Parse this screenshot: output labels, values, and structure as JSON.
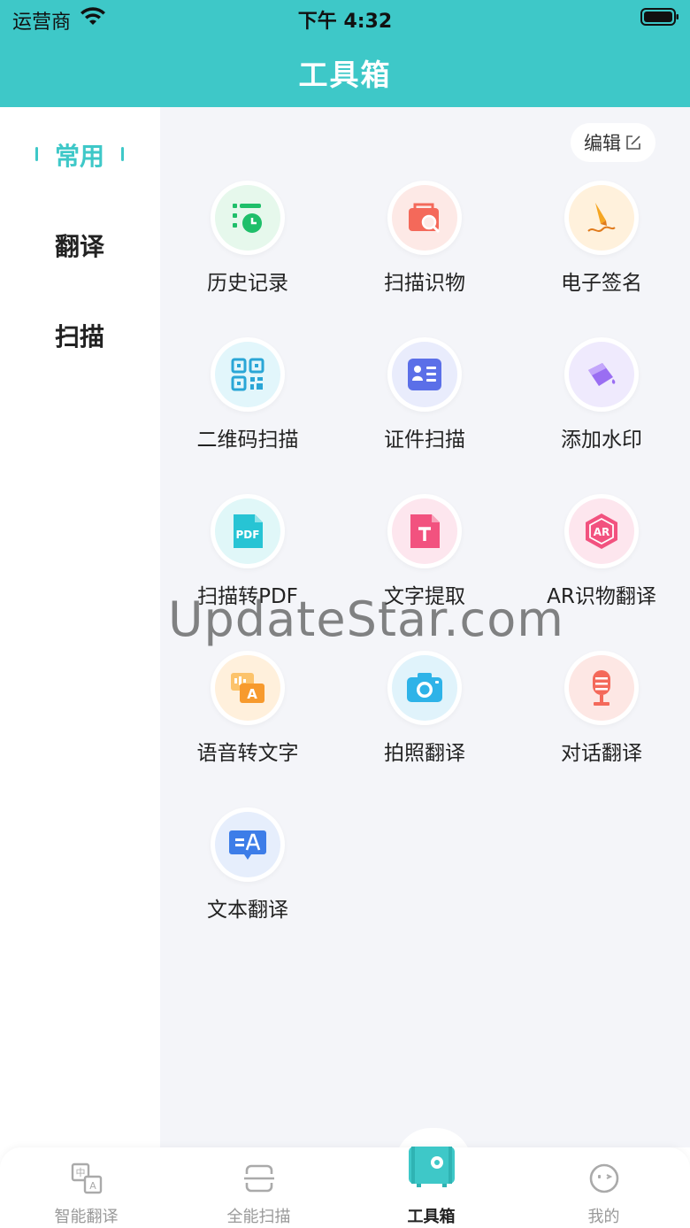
{
  "status": {
    "carrier": "运营商",
    "time": "下午 4:32"
  },
  "header": {
    "title": "工具箱"
  },
  "sidebar": {
    "items": [
      {
        "label": "常用"
      },
      {
        "label": "翻译"
      },
      {
        "label": "扫描"
      }
    ]
  },
  "edit": {
    "label": "编辑"
  },
  "tools": [
    {
      "label": "历史记录",
      "icon": "history-icon"
    },
    {
      "label": "扫描识物",
      "icon": "scan-object-icon"
    },
    {
      "label": "电子签名",
      "icon": "signature-icon"
    },
    {
      "label": "二维码扫描",
      "icon": "qrcode-icon"
    },
    {
      "label": "证件扫描",
      "icon": "id-card-icon"
    },
    {
      "label": "添加水印",
      "icon": "watermark-icon"
    },
    {
      "label": "扫描转PDF",
      "icon": "pdf-icon"
    },
    {
      "label": "文字提取",
      "icon": "text-extract-icon"
    },
    {
      "label": "AR识物翻译",
      "icon": "ar-icon"
    },
    {
      "label": "语音转文字",
      "icon": "voice-to-text-icon"
    },
    {
      "label": "拍照翻译",
      "icon": "camera-icon"
    },
    {
      "label": "对话翻译",
      "icon": "microphone-icon"
    },
    {
      "label": "文本翻译",
      "icon": "text-translate-icon"
    }
  ],
  "watermark": "UpdateStar.com",
  "tabbar": {
    "items": [
      {
        "label": "智能翻译"
      },
      {
        "label": "全能扫描"
      },
      {
        "label": "工具箱"
      },
      {
        "label": "我的"
      }
    ]
  },
  "colors": {
    "accent": "#3ec8c8",
    "content_bg": "#f4f5f9"
  }
}
